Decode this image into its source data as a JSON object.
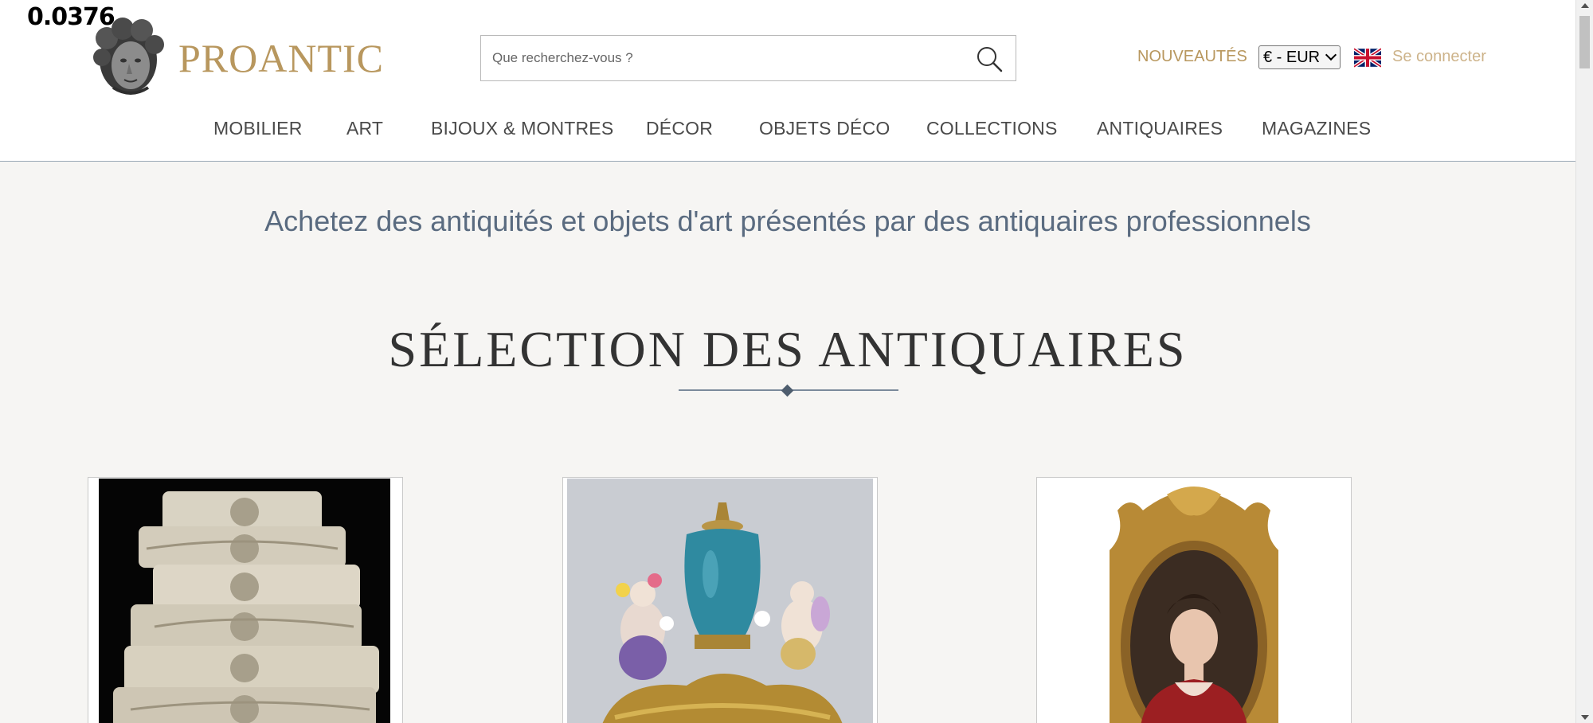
{
  "overlay": {
    "number": "0.0376"
  },
  "header": {
    "logo_text": "PROANTIC",
    "search": {
      "placeholder": "Que recherchez-vous ?",
      "value": ""
    },
    "new_label": "NOUVEAUTÉS",
    "currency": "€ - EUR",
    "login_label": "Se connecter"
  },
  "nav": {
    "items": [
      {
        "label": "MOBILIER"
      },
      {
        "label": "ART"
      },
      {
        "label": "BIJOUX & MONTRES"
      },
      {
        "label": "DÉCOR"
      },
      {
        "label": "OBJETS DÉCO"
      },
      {
        "label": "COLLECTIONS"
      },
      {
        "label": "ANTIQUAIRES"
      },
      {
        "label": "MAGAZINES"
      }
    ]
  },
  "main": {
    "tagline": "Achetez des antiquités et objets d'art présentés par des antiquaires professionnels",
    "section_title": "SÉLECTION DES ANTIQUAIRES"
  },
  "cards": [
    {
      "image": "carved-stone-ornament-photo"
    },
    {
      "image": "porcelain-vase-with-cherubs-photo"
    },
    {
      "image": "framed-portrait-painting-photo"
    }
  ],
  "icons": {
    "logo": "sculpted-head-icon",
    "search": "search-icon",
    "flag": "uk-flag-icon"
  },
  "colors": {
    "brand_gold": "#b8975e",
    "tagline_slate": "#5a6b80",
    "page_bg": "#f6f5f3"
  }
}
